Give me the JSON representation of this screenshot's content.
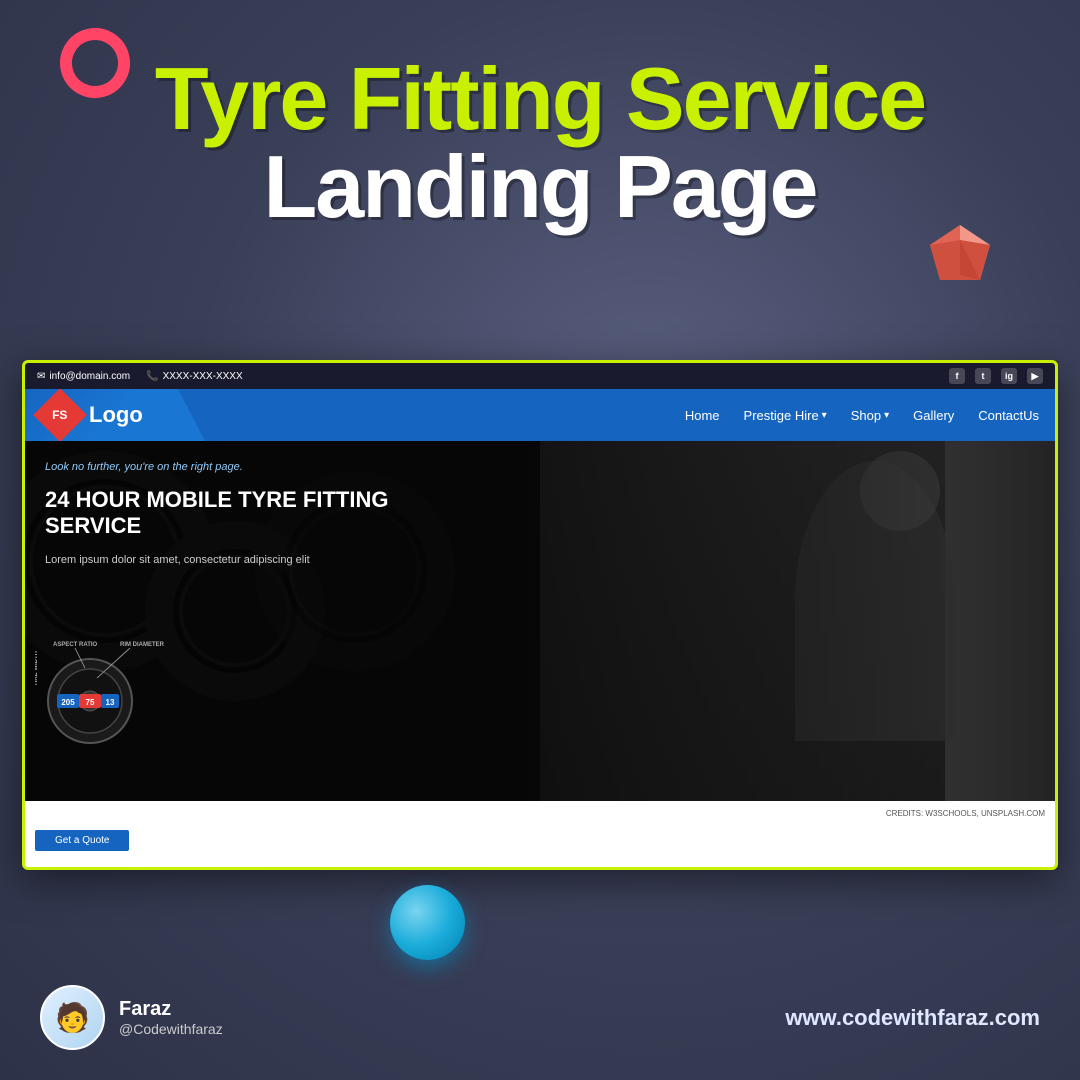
{
  "page": {
    "title": "Tyre Fitting Service Landing Page",
    "title_line1": "Tyre Fitting Service",
    "title_line2": "Landing Page"
  },
  "website": "www.codewithfaraz.com",
  "author": {
    "name": "Faraz",
    "handle": "@Codewithfaraz"
  },
  "browser": {
    "info_bar": {
      "email": "info@domain.com",
      "phone": "XXXX-XXX-XXXX"
    },
    "nav": {
      "logo_text": "Logo",
      "logo_initials": "FS",
      "links": [
        "Home",
        "Prestige Hire ▾",
        "Shop ▾",
        "Gallery",
        "ContactUs"
      ]
    },
    "hero": {
      "tagline": "Look no further, you're on the right page.",
      "title": "24 HOUR MOBILE TYRE FITTING SERVICE",
      "description": "Lorem ipsum dolor sit amet, consectetur adipiscing elit",
      "tyre_labels": {
        "aspect_ratio": "ASPECT RATIO",
        "rim_diameter": "RIM DIAMETER",
        "tire_width": "TIRE WIDTH",
        "numbers": [
          "205",
          "75",
          "13"
        ]
      }
    },
    "credits": "CREDITS: W3SCHOOLS, UNSPLASH.COM"
  },
  "icons": {
    "email": "✉",
    "phone": "📞",
    "facebook": "f",
    "twitter": "t",
    "instagram": "ig",
    "youtube": "▶"
  }
}
